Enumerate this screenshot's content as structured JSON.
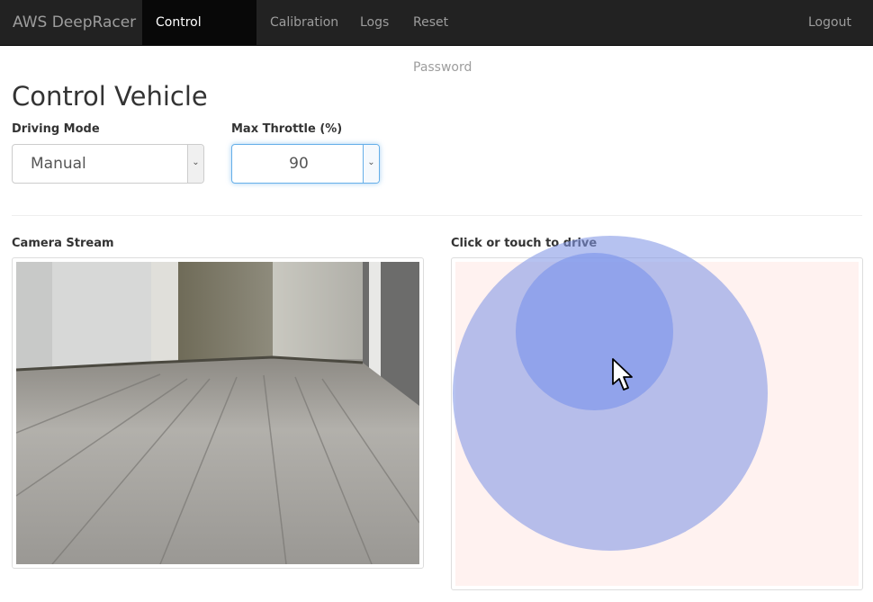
{
  "navbar": {
    "brand": "AWS DeepRacer",
    "items": [
      {
        "label": "Control Vehicle",
        "active": true
      },
      {
        "label": "Calibration",
        "active": false
      },
      {
        "label": "Logs",
        "active": false
      },
      {
        "label": "Reset Password",
        "active": false
      }
    ],
    "logout_label": "Logout"
  },
  "page": {
    "title": "Control Vehicle"
  },
  "controls": {
    "driving_mode": {
      "label": "Driving Mode",
      "value": "Manual"
    },
    "max_throttle": {
      "label": "Max Throttle (%)",
      "value": "90"
    }
  },
  "camera": {
    "label": "Camera Stream"
  },
  "drive": {
    "label": "Click or touch to drive"
  },
  "icons": {
    "select_arrow": "chevron-down-icon",
    "cursor": "mouse-pointer-icon"
  },
  "colors": {
    "navbar_bg": "#222222",
    "nav_active_bg": "#080808",
    "joystick": "#8296e6",
    "drive_area_bg": "#fff2f0",
    "focus_border": "#66afe9"
  }
}
